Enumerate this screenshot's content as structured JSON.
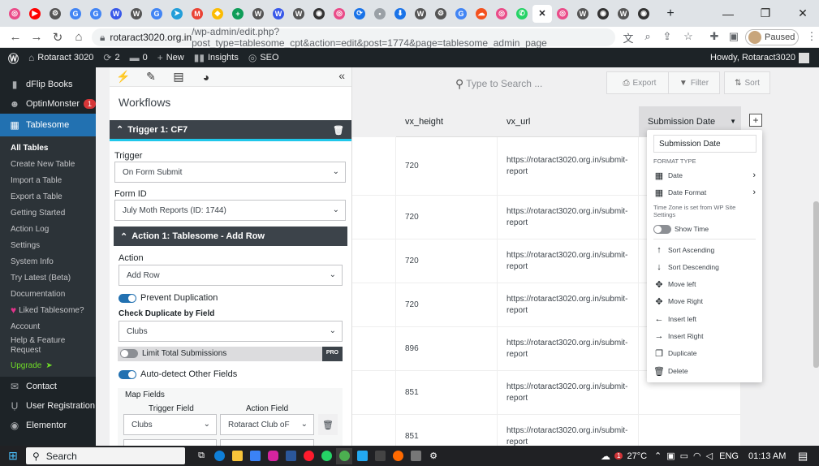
{
  "browser": {
    "tabs": [
      {
        "icon": "dribbble-icon",
        "color": "#ea4c89",
        "glyph": "◎"
      },
      {
        "icon": "youtube-icon",
        "color": "#ff0000",
        "glyph": "▶"
      },
      {
        "icon": "rotary-icon",
        "color": "#555555",
        "glyph": "⚙"
      },
      {
        "icon": "google-icon",
        "color": "#4285f4",
        "glyph": "G"
      },
      {
        "icon": "google-icon",
        "color": "#4285f4",
        "glyph": "G"
      },
      {
        "icon": "wordpress-icon",
        "color": "#3858e9",
        "glyph": "W"
      },
      {
        "icon": "wordpress-icon",
        "color": "#555555",
        "glyph": "W"
      },
      {
        "icon": "google-icon",
        "color": "#4285f4",
        "glyph": "G"
      },
      {
        "icon": "telegram-icon",
        "color": "#229ed9",
        "glyph": "➤"
      },
      {
        "icon": "gmail-icon",
        "color": "#ea4335",
        "glyph": "M"
      },
      {
        "icon": "google-ads-icon",
        "color": "#fbbc04",
        "glyph": "◆"
      },
      {
        "icon": "sheets-plus-icon",
        "color": "#0f9d58",
        "glyph": "+"
      },
      {
        "icon": "wordpress-icon",
        "color": "#555555",
        "glyph": "W"
      },
      {
        "icon": "wordpress-icon",
        "color": "#3858e9",
        "glyph": "W"
      },
      {
        "icon": "wordpress-icon",
        "color": "#555555",
        "glyph": "W"
      },
      {
        "icon": "github-icon",
        "color": "#333333",
        "glyph": "◉"
      },
      {
        "icon": "dribbble-icon",
        "color": "#ea4c89",
        "glyph": "◎"
      },
      {
        "icon": "sync-icon",
        "color": "#1a73e8",
        "glyph": "⟳"
      },
      {
        "icon": "dot-icon",
        "color": "#9aa0a6",
        "glyph": "•"
      },
      {
        "icon": "download-icon",
        "color": "#1a73e8",
        "glyph": "⬇"
      },
      {
        "icon": "wordpress-icon",
        "color": "#555555",
        "glyph": "W"
      },
      {
        "icon": "rotary-icon",
        "color": "#555555",
        "glyph": "⚙"
      },
      {
        "icon": "google-icon",
        "color": "#4285f4",
        "glyph": "G"
      },
      {
        "icon": "cloud-icon",
        "color": "#f4511e",
        "glyph": "☁"
      },
      {
        "icon": "dribbble-icon",
        "color": "#ea4c89",
        "glyph": "◎"
      },
      {
        "icon": "whatsapp-icon",
        "color": "#25d366",
        "glyph": "✆"
      },
      {
        "icon": "close-icon",
        "color": "#202124",
        "glyph": "✕",
        "active": true
      },
      {
        "icon": "dribbble-icon",
        "color": "#ea4c89",
        "glyph": "◎"
      },
      {
        "icon": "wordpress-icon",
        "color": "#555555",
        "glyph": "W"
      },
      {
        "icon": "github-icon",
        "color": "#333333",
        "glyph": "◉"
      },
      {
        "icon": "wordpress-icon",
        "color": "#555555",
        "glyph": "W"
      },
      {
        "icon": "github-icon",
        "color": "#333333",
        "glyph": "◉"
      }
    ],
    "new_tab_glyph": "+",
    "url_host": "rotaract3020.org.in",
    "url_path": "/wp-admin/edit.php?post_type=tablesome_cpt&action=edit&post=1774&page=tablesome_admin_page",
    "profile_label": "Paused"
  },
  "adminbar": {
    "site_name": "Rotaract 3020",
    "updates_count": "2",
    "comments_count": "0",
    "new_label": "New",
    "insights_label": "Insights",
    "seo_label": "SEO",
    "howdy": "Howdy, Rotaract3020"
  },
  "sidebar": {
    "top_items": [
      {
        "label": "dFlip Books",
        "icon": "book-icon",
        "glyph": "▮"
      },
      {
        "label": "OptinMonster",
        "icon": "optinmonster-icon",
        "glyph": "☻",
        "badge": "1"
      }
    ],
    "active_item": {
      "label": "Tablesome",
      "icon": "table-icon",
      "glyph": "▦"
    },
    "submenu": [
      {
        "label": "All Tables",
        "current": true
      },
      {
        "label": "Create New Table"
      },
      {
        "label": "Import a Table"
      },
      {
        "label": "Export a Table"
      },
      {
        "label": "Getting Started"
      },
      {
        "label": "Action Log"
      },
      {
        "label": "Settings"
      },
      {
        "label": "System Info"
      },
      {
        "label": "Try Latest (Beta)"
      },
      {
        "label": "Documentation"
      },
      {
        "label": "Liked Tablesome?",
        "heart": true
      },
      {
        "label": "Account"
      },
      {
        "label": "Help & Feature Request",
        "two_line": true
      },
      {
        "label": "Upgrade",
        "upgrade": true
      }
    ],
    "bottom_items": [
      {
        "label": "Contact",
        "icon": "mail-icon",
        "glyph": "✉"
      },
      {
        "label": "User Registration",
        "icon": "user-registration-icon",
        "glyph": "Ụ"
      },
      {
        "label": "Elementor",
        "icon": "elementor-icon",
        "glyph": "◉"
      }
    ]
  },
  "workflow": {
    "title": "Workflows",
    "trigger_bar": "Trigger 1: CF7",
    "trigger_label": "Trigger",
    "trigger_value": "On Form Submit",
    "form_id_label": "Form ID",
    "form_id_value": "July Moth Reports (ID: 1744)",
    "action_bar": "Action 1: Tablesome - Add Row",
    "action_label": "Action",
    "action_value": "Add Row",
    "prevent_dup": "Prevent Duplication",
    "check_dup_label": "Check Duplicate by Field",
    "check_dup_value": "Clubs",
    "limit_label": "Limit Total Submissions",
    "pro_badge": "PRO",
    "auto_detect": "Auto-detect Other Fields",
    "map_fields": "Map Fields",
    "trigger_field_hdr": "Trigger Field",
    "action_field_hdr": "Action Field",
    "map_trigger_value": "Clubs",
    "map_action_value": "Rotaract Club oF"
  },
  "table": {
    "search_placeholder": "Type to Search ...",
    "export_label": "Export",
    "filter_label": "Filter",
    "sort_label": "Sort",
    "columns": [
      "vx_height",
      "vx_url",
      "Submission Date"
    ],
    "rows": [
      {
        "height": "720",
        "url": "https://rotaract3020.org.in/submit-report"
      },
      {
        "height": "720",
        "url": "https://rotaract3020.org.in/submit-report"
      },
      {
        "height": "720",
        "url": "https://rotaract3020.org.in/submit-report"
      },
      {
        "height": "720",
        "url": "https://rotaract3020.org.in/submit-report"
      },
      {
        "height": "896",
        "url": "https://rotaract3020.org.in/submit-report"
      },
      {
        "height": "851",
        "url": "https://rotaract3020.org.in/submit-report"
      },
      {
        "height": "851",
        "url": "https://rotaract3020.org.in/submit-report"
      }
    ]
  },
  "column_menu": {
    "name_value": "Submission Date",
    "format_type": "FORMAT TYPE",
    "date": "Date",
    "date_format": "Date Format",
    "timezone_note": "Time Zone is set from WP Site Settings",
    "show_time": "Show Time",
    "sort_asc": "Sort Ascending",
    "sort_desc": "Sort Descending",
    "move_left": "Move left",
    "move_right": "Move Right",
    "insert_left": "Insert left",
    "insert_right": "Insert Right",
    "duplicate": "Duplicate",
    "delete": "Delete"
  },
  "taskbar": {
    "search": "Search",
    "weather_temp": "27°C",
    "weather_badge": "1",
    "language": "ENG",
    "time": "01:13 AM"
  }
}
